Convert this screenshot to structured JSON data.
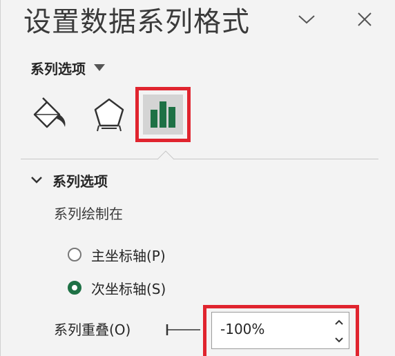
{
  "pane": {
    "title": "设置数据系列格式"
  },
  "header": {
    "collapse_icon": "chevron-down-icon",
    "close_icon": "close-icon"
  },
  "options_dropdown": {
    "label": "系列选项",
    "icon": "caret-down-icon"
  },
  "tabs": [
    {
      "id": "fill-line",
      "icon": "paint-bucket-icon",
      "selected": false
    },
    {
      "id": "effects",
      "icon": "pentagon-icon",
      "selected": false
    },
    {
      "id": "series-options",
      "icon": "column-chart-icon",
      "selected": true
    }
  ],
  "section": {
    "title": "系列选项",
    "expanded": true,
    "plot_on_label": "系列绘制在",
    "axis_options": [
      {
        "label": "主坐标轴(P)",
        "checked": false
      },
      {
        "label": "次坐标轴(S)",
        "checked": true
      }
    ],
    "overlap": {
      "label": "系列重叠(O)",
      "value": "-100%"
    }
  },
  "colors": {
    "accent_green": "#1e7145",
    "highlight_red": "#e0242e",
    "pane_background": "#f3f3f3"
  }
}
